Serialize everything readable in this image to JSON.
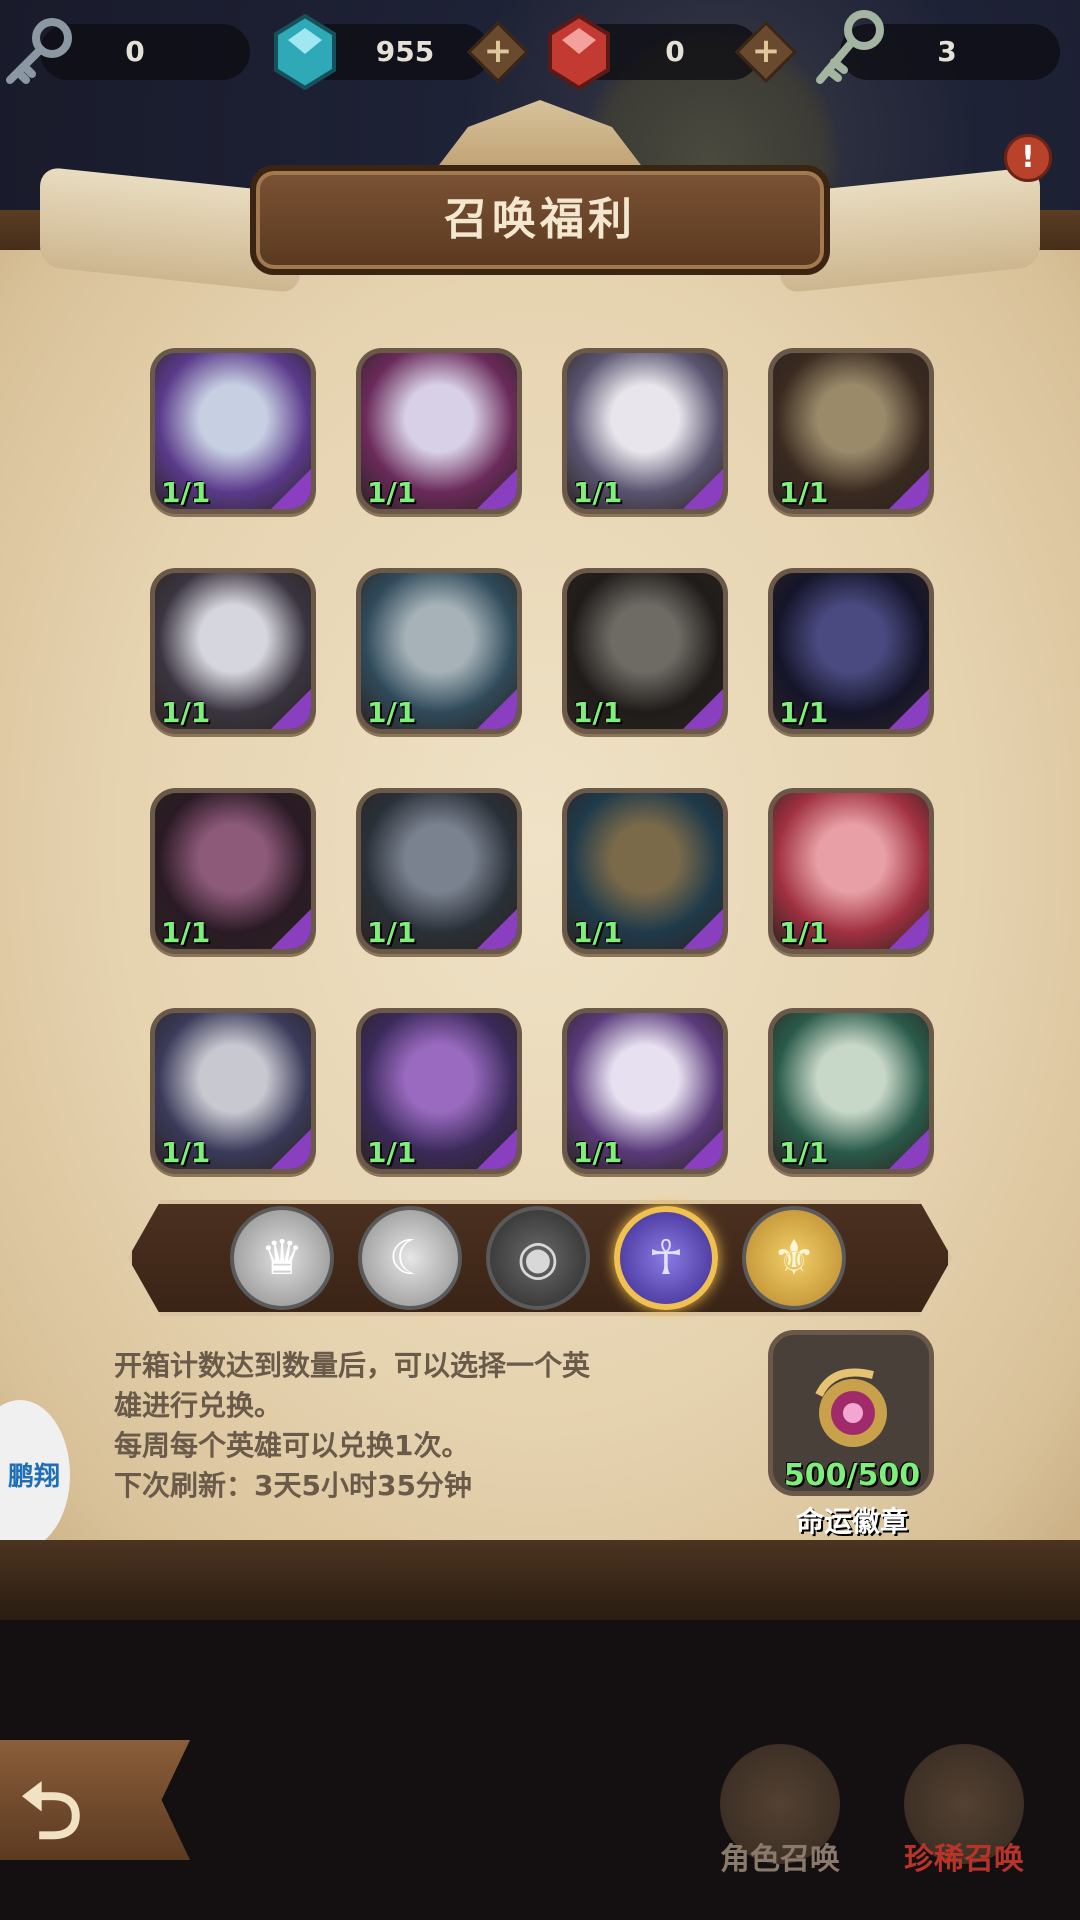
{
  "resources": [
    {
      "icon": "key-icon",
      "value": "0"
    },
    {
      "icon": "blue-gem-icon",
      "value": "955",
      "has_plus": true
    },
    {
      "icon": "red-gem-icon",
      "value": "0",
      "has_plus": true
    },
    {
      "icon": "ornate-key-icon",
      "value": "3"
    }
  ],
  "title": "召唤福利",
  "heroes": [
    {
      "count": "1/1"
    },
    {
      "count": "1/1"
    },
    {
      "count": "1/1"
    },
    {
      "count": "1/1"
    },
    {
      "count": "1/1"
    },
    {
      "count": "1/1"
    },
    {
      "count": "1/1"
    },
    {
      "count": "1/1"
    },
    {
      "count": "1/1"
    },
    {
      "count": "1/1"
    },
    {
      "count": "1/1"
    },
    {
      "count": "1/1"
    },
    {
      "count": "1/1"
    },
    {
      "count": "1/1"
    },
    {
      "count": "1/1"
    },
    {
      "count": "1/1"
    }
  ],
  "factions": [
    {
      "name": "crown-faction-icon",
      "selected": false
    },
    {
      "name": "moon-faction-icon",
      "selected": false
    },
    {
      "name": "eye-faction-icon",
      "selected": false
    },
    {
      "name": "ghost-flame-faction-icon",
      "selected": true
    },
    {
      "name": "angel-wings-faction-icon",
      "selected": false
    }
  ],
  "info": {
    "line1": "开箱计数达到数量后，可以选择一个英",
    "line2": "雄进行兑换。",
    "line3": "每周每个英雄可以兑换1次。",
    "line4": "下次刷新：3天5小时35分钟"
  },
  "badge": {
    "count": "500/500",
    "name": "命运徽章"
  },
  "side_logo": {
    "text": "鹏翔"
  },
  "bottom_nav": {
    "character_summon": "角色召唤",
    "rare_summon": "珍稀召唤"
  },
  "colors": {
    "count_green": "#7ef07a",
    "rare_red": "#b8332a",
    "purple_corner": "#8a3fc1"
  }
}
